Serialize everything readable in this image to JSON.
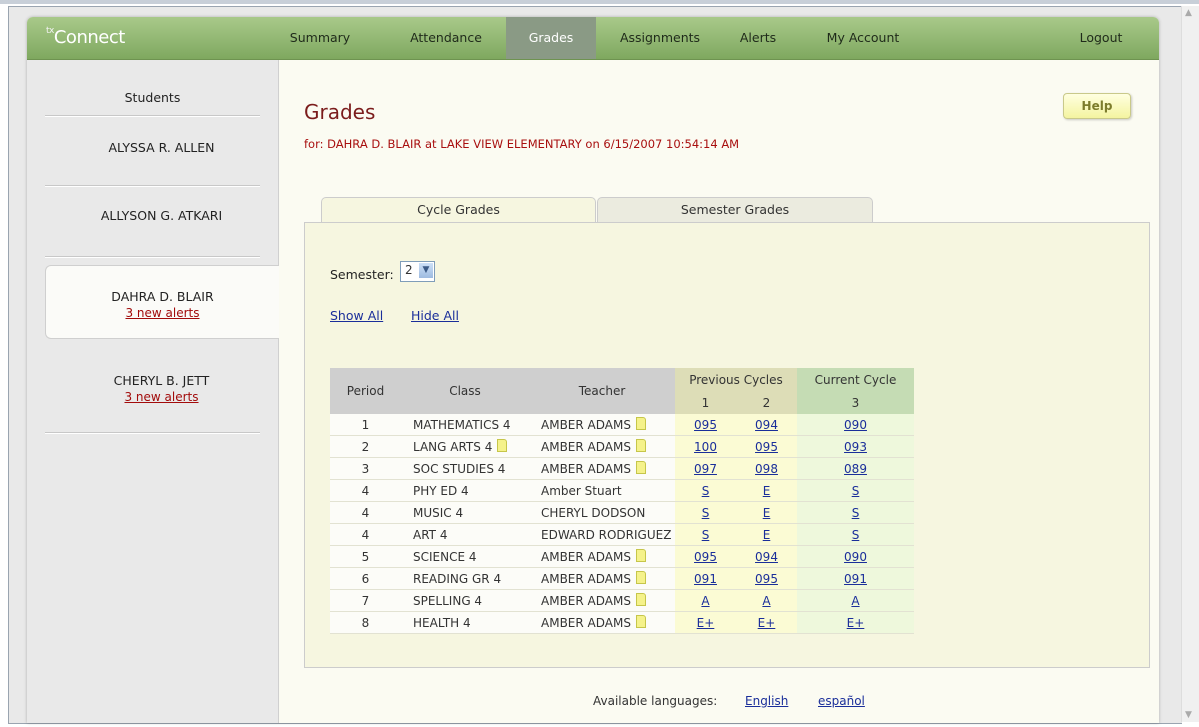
{
  "app": {
    "logo_prefix": "tx",
    "logo_text": "Connect"
  },
  "nav": {
    "items": [
      "Summary",
      "Attendance",
      "Grades",
      "Assignments",
      "Alerts",
      "My Account"
    ],
    "logout": "Logout",
    "active": "Grades"
  },
  "sidebar": {
    "title": "Students",
    "students": [
      {
        "name": "ALYSSA R. ALLEN",
        "alerts": ""
      },
      {
        "name": "ALLYSON G. ATKARI",
        "alerts": ""
      },
      {
        "name": "DAHRA D. BLAIR",
        "alerts": "3 new alerts"
      },
      {
        "name": "CHERYL B. JETT",
        "alerts": "3 new alerts"
      }
    ],
    "active_student": "DAHRA D. BLAIR"
  },
  "page": {
    "title": "Grades",
    "subtitle": "for: DAHRA D. BLAIR at LAKE VIEW ELEMENTARY on 6/15/2007 10:54:14 AM",
    "help": "Help"
  },
  "tabs": {
    "cycle": "Cycle Grades",
    "semester": "Semester Grades",
    "active": "Cycle Grades"
  },
  "filters": {
    "semester_label": "Semester:",
    "semester_value": "2"
  },
  "links": {
    "show_all": "Show All",
    "hide_all": "Hide All"
  },
  "table": {
    "headers": {
      "period": "Period",
      "class": "Class",
      "teacher": "Teacher",
      "previous": "Previous Cycles",
      "current": "Current Cycle",
      "cycle1": "1",
      "cycle2": "2",
      "cycle3": "3"
    },
    "rows": [
      {
        "period": "1",
        "class": "MATHEMATICS 4",
        "class_note": false,
        "teacher": "AMBER ADAMS",
        "teacher_note": true,
        "c1": "095",
        "c2": "094",
        "c3": "090"
      },
      {
        "period": "2",
        "class": "LANG ARTS 4",
        "class_note": true,
        "teacher": "AMBER ADAMS",
        "teacher_note": true,
        "c1": "100",
        "c2": "095",
        "c3": "093"
      },
      {
        "period": "3",
        "class": "SOC STUDIES 4",
        "class_note": false,
        "teacher": "AMBER ADAMS",
        "teacher_note": true,
        "c1": "097",
        "c2": "098",
        "c3": "089"
      },
      {
        "period": "4",
        "class": "PHY ED 4",
        "class_note": false,
        "teacher": "Amber Stuart",
        "teacher_note": false,
        "c1": "S",
        "c2": "E",
        "c3": "S"
      },
      {
        "period": "4",
        "class": "MUSIC 4",
        "class_note": false,
        "teacher": "CHERYL DODSON",
        "teacher_note": false,
        "c1": "S",
        "c2": "E",
        "c3": "S"
      },
      {
        "period": "4",
        "class": "ART 4",
        "class_note": false,
        "teacher": "EDWARD RODRIGUEZ",
        "teacher_note": false,
        "c1": "S",
        "c2": "E",
        "c3": "S"
      },
      {
        "period": "5",
        "class": "SCIENCE 4",
        "class_note": false,
        "teacher": "AMBER ADAMS",
        "teacher_note": true,
        "c1": "095",
        "c2": "094",
        "c3": "090"
      },
      {
        "period": "6",
        "class": "READING GR 4",
        "class_note": false,
        "teacher": "AMBER ADAMS",
        "teacher_note": true,
        "c1": "091",
        "c2": "095",
        "c3": "091"
      },
      {
        "period": "7",
        "class": "SPELLING 4",
        "class_note": false,
        "teacher": "AMBER ADAMS",
        "teacher_note": true,
        "c1": "A",
        "c2": "A",
        "c3": "A"
      },
      {
        "period": "8",
        "class": "HEALTH 4",
        "class_note": false,
        "teacher": "AMBER ADAMS",
        "teacher_note": true,
        "c1": "E+",
        "c2": "E+",
        "c3": "E+"
      }
    ]
  },
  "footer": {
    "label": "Available languages:",
    "english": "English",
    "spanish": "español"
  },
  "colors": {
    "nav_green": "#8fb56c",
    "title_red": "#7b1c1c",
    "alert_red": "#a20b0b",
    "link_blue": "#1a2e9a"
  }
}
